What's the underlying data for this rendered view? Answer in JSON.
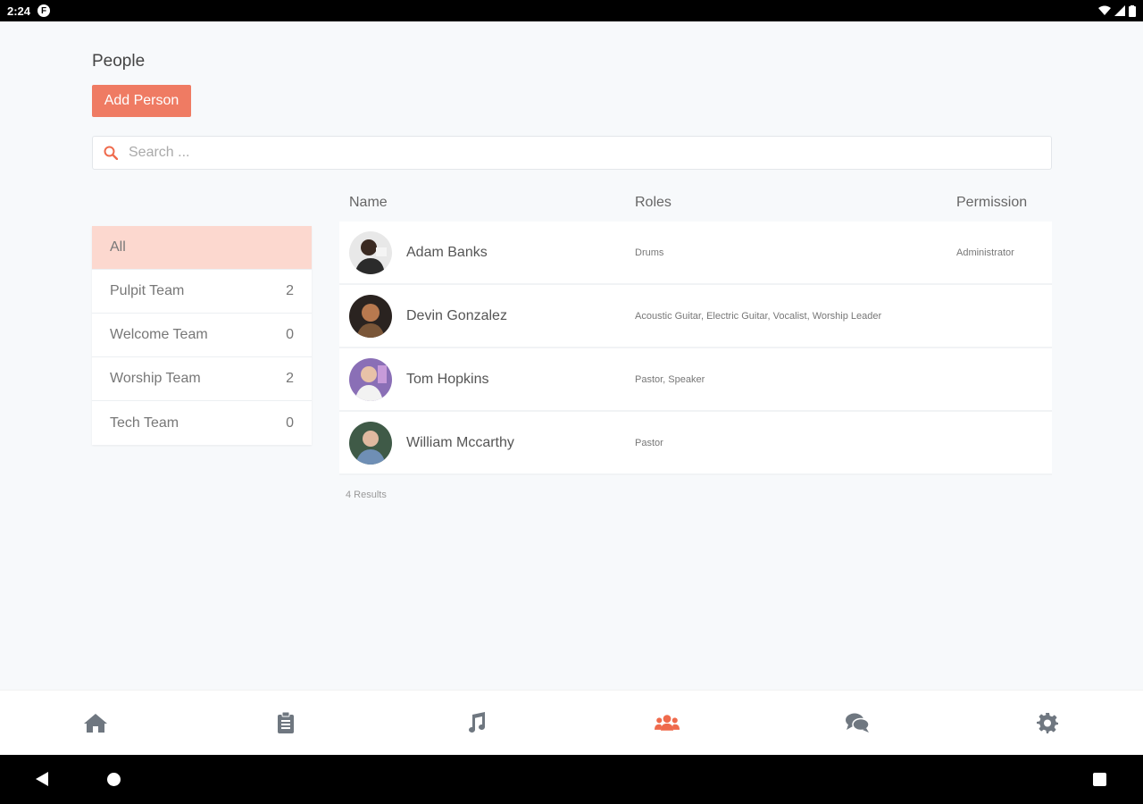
{
  "status_bar": {
    "time": "2:24",
    "app_badge": "F"
  },
  "page": {
    "title": "People",
    "add_button_label": "Add Person"
  },
  "search": {
    "placeholder": "Search ..."
  },
  "groups": [
    {
      "label": "All",
      "count": ""
    },
    {
      "label": "Pulpit Team",
      "count": "2"
    },
    {
      "label": "Welcome Team",
      "count": "0"
    },
    {
      "label": "Worship Team",
      "count": "2"
    },
    {
      "label": "Tech Team",
      "count": "0"
    }
  ],
  "table": {
    "headers": {
      "name": "Name",
      "roles": "Roles",
      "permission": "Permission"
    },
    "rows": [
      {
        "name": "Adam Banks",
        "roles": "Drums",
        "permission": "Administrator"
      },
      {
        "name": "Devin Gonzalez",
        "roles": "Acoustic Guitar, Electric Guitar, Vocalist, Worship Leader",
        "permission": ""
      },
      {
        "name": "Tom Hopkins",
        "roles": "Pastor, Speaker",
        "permission": ""
      },
      {
        "name": "William Mccarthy",
        "roles": "Pastor",
        "permission": ""
      }
    ],
    "results_text": "4 Results"
  },
  "bottom_nav": [
    {
      "icon": "home-icon",
      "active": false
    },
    {
      "icon": "clipboard-icon",
      "active": false
    },
    {
      "icon": "music-note-icon",
      "active": false
    },
    {
      "icon": "users-icon",
      "active": true
    },
    {
      "icon": "chat-icon",
      "active": false
    },
    {
      "icon": "gear-icon",
      "active": false
    }
  ],
  "colors": {
    "accent": "#ef7b63",
    "active_group_bg": "#fcd8cf",
    "nav_inactive": "#6f7780",
    "nav_active": "#ef6a4c"
  }
}
